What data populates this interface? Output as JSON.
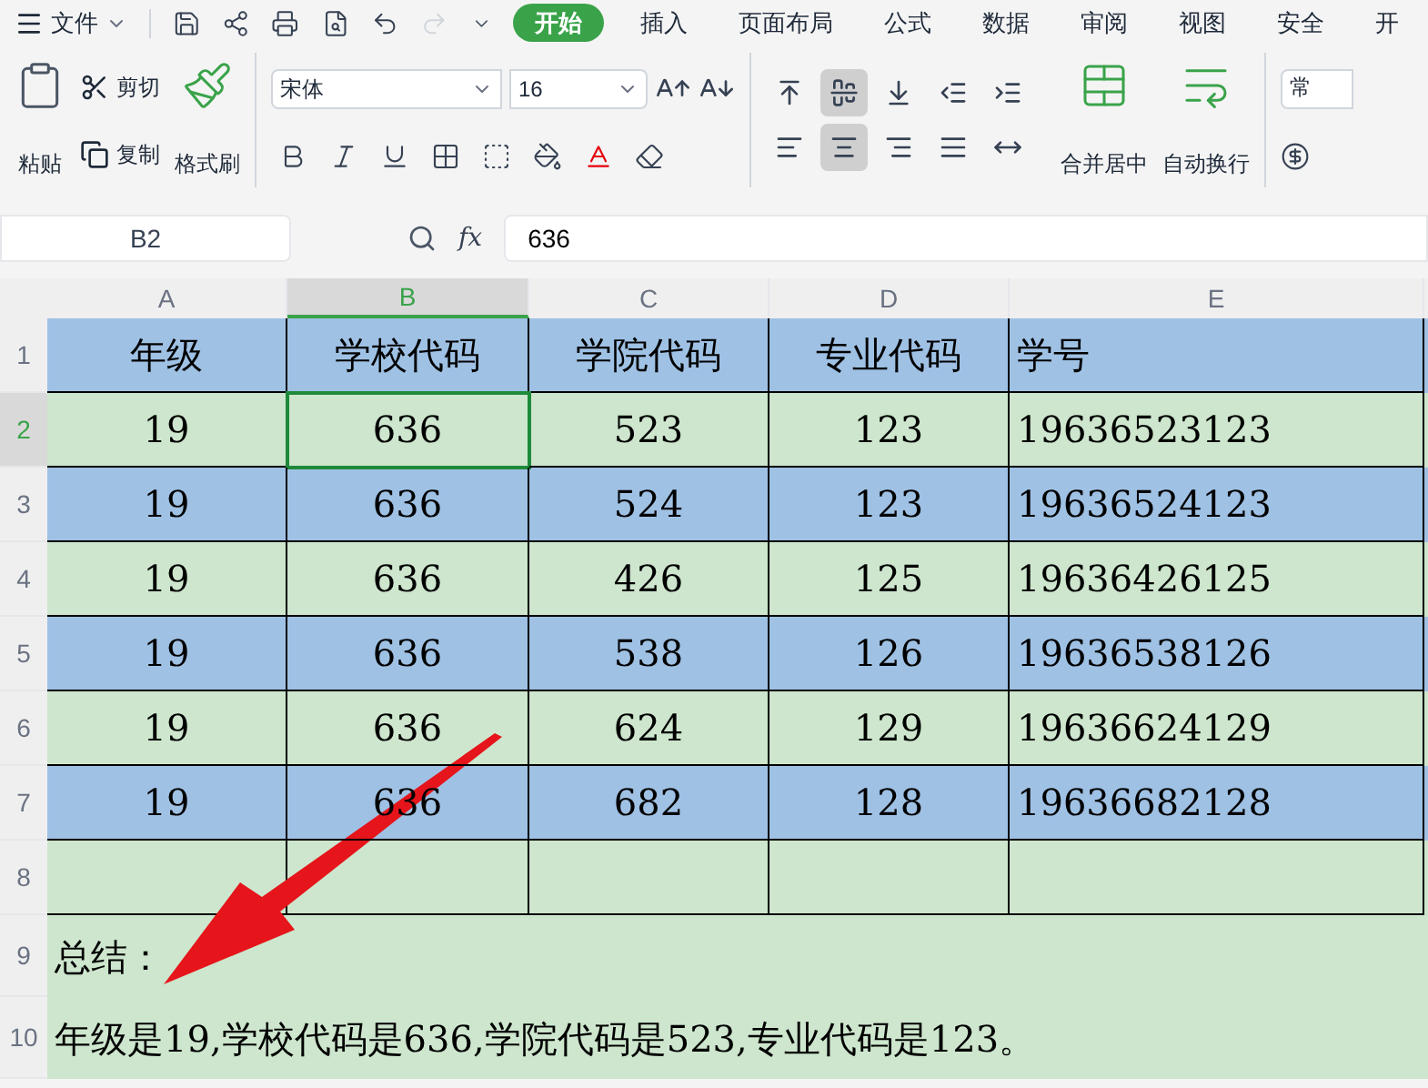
{
  "menu": {
    "file_label": "文件",
    "tabs": [
      {
        "label": "开始",
        "selected": true
      },
      {
        "label": "插入",
        "selected": false
      },
      {
        "label": "页面布局",
        "selected": false
      },
      {
        "label": "公式",
        "selected": false
      },
      {
        "label": "数据",
        "selected": false
      },
      {
        "label": "审阅",
        "selected": false
      },
      {
        "label": "视图",
        "selected": false
      },
      {
        "label": "安全",
        "selected": false
      },
      {
        "label": "开",
        "selected": false
      }
    ]
  },
  "ribbon": {
    "paste": "粘贴",
    "cut": "剪切",
    "copy": "复制",
    "format_painter": "格式刷",
    "font": "宋体",
    "font_size": "16",
    "merge": "合并居中",
    "wrap": "自动换行",
    "number_format": "常",
    "align_buttons": [
      {
        "kind": "top",
        "selected": false
      },
      {
        "kind": "middle",
        "selected": true
      },
      {
        "kind": "bottom",
        "selected": false
      },
      {
        "kind": "outdent",
        "selected": false
      },
      {
        "kind": "indent",
        "selected": false
      },
      {
        "kind": "left",
        "selected": false
      },
      {
        "kind": "center",
        "selected": true
      },
      {
        "kind": "right",
        "selected": false
      },
      {
        "kind": "justify",
        "selected": false
      },
      {
        "kind": "distribute",
        "selected": false
      }
    ]
  },
  "formula_bar": {
    "name_box": "B2",
    "fx": "fx",
    "value": "636"
  },
  "columns": [
    {
      "label": "A",
      "selected": false
    },
    {
      "label": "B",
      "selected": true
    },
    {
      "label": "C",
      "selected": false
    },
    {
      "label": "D",
      "selected": false
    },
    {
      "label": "E",
      "selected": false
    }
  ],
  "rows": [
    {
      "number": "1",
      "kind": "table",
      "selected": false,
      "color": "#9fc1e4",
      "cells": [
        "年级",
        "学校代码",
        "学院代码",
        "专业代码",
        "学号"
      ]
    },
    {
      "number": "2",
      "kind": "table",
      "selected": true,
      "color": "#cde6cd",
      "cells": [
        "19",
        "636",
        "523",
        "123",
        "19636523123"
      ]
    },
    {
      "number": "3",
      "kind": "table",
      "selected": false,
      "color": "#9fc1e4",
      "cells": [
        "19",
        "636",
        "524",
        "123",
        "19636524123"
      ]
    },
    {
      "number": "4",
      "kind": "table",
      "selected": false,
      "color": "#cde6cd",
      "cells": [
        "19",
        "636",
        "426",
        "125",
        "19636426125"
      ]
    },
    {
      "number": "5",
      "kind": "table",
      "selected": false,
      "color": "#9fc1e4",
      "cells": [
        "19",
        "636",
        "538",
        "126",
        "19636538126"
      ]
    },
    {
      "number": "6",
      "kind": "table",
      "selected": false,
      "color": "#cde6cd",
      "cells": [
        "19",
        "636",
        "624",
        "129",
        "19636624129"
      ]
    },
    {
      "number": "7",
      "kind": "table",
      "selected": false,
      "color": "#9fc1e4",
      "cells": [
        "19",
        "636",
        "682",
        "128",
        "19636682128"
      ]
    },
    {
      "number": "8",
      "kind": "blank",
      "selected": false,
      "color": "#cde6cd"
    },
    {
      "number": "9",
      "kind": "note",
      "selected": false,
      "color": "#cde6cd",
      "text": "总结："
    },
    {
      "number": "10",
      "kind": "note",
      "selected": false,
      "color": "#cde6cd",
      "text": "年级是19,学校代码是636,学院代码是523,专业代码是123。"
    }
  ]
}
